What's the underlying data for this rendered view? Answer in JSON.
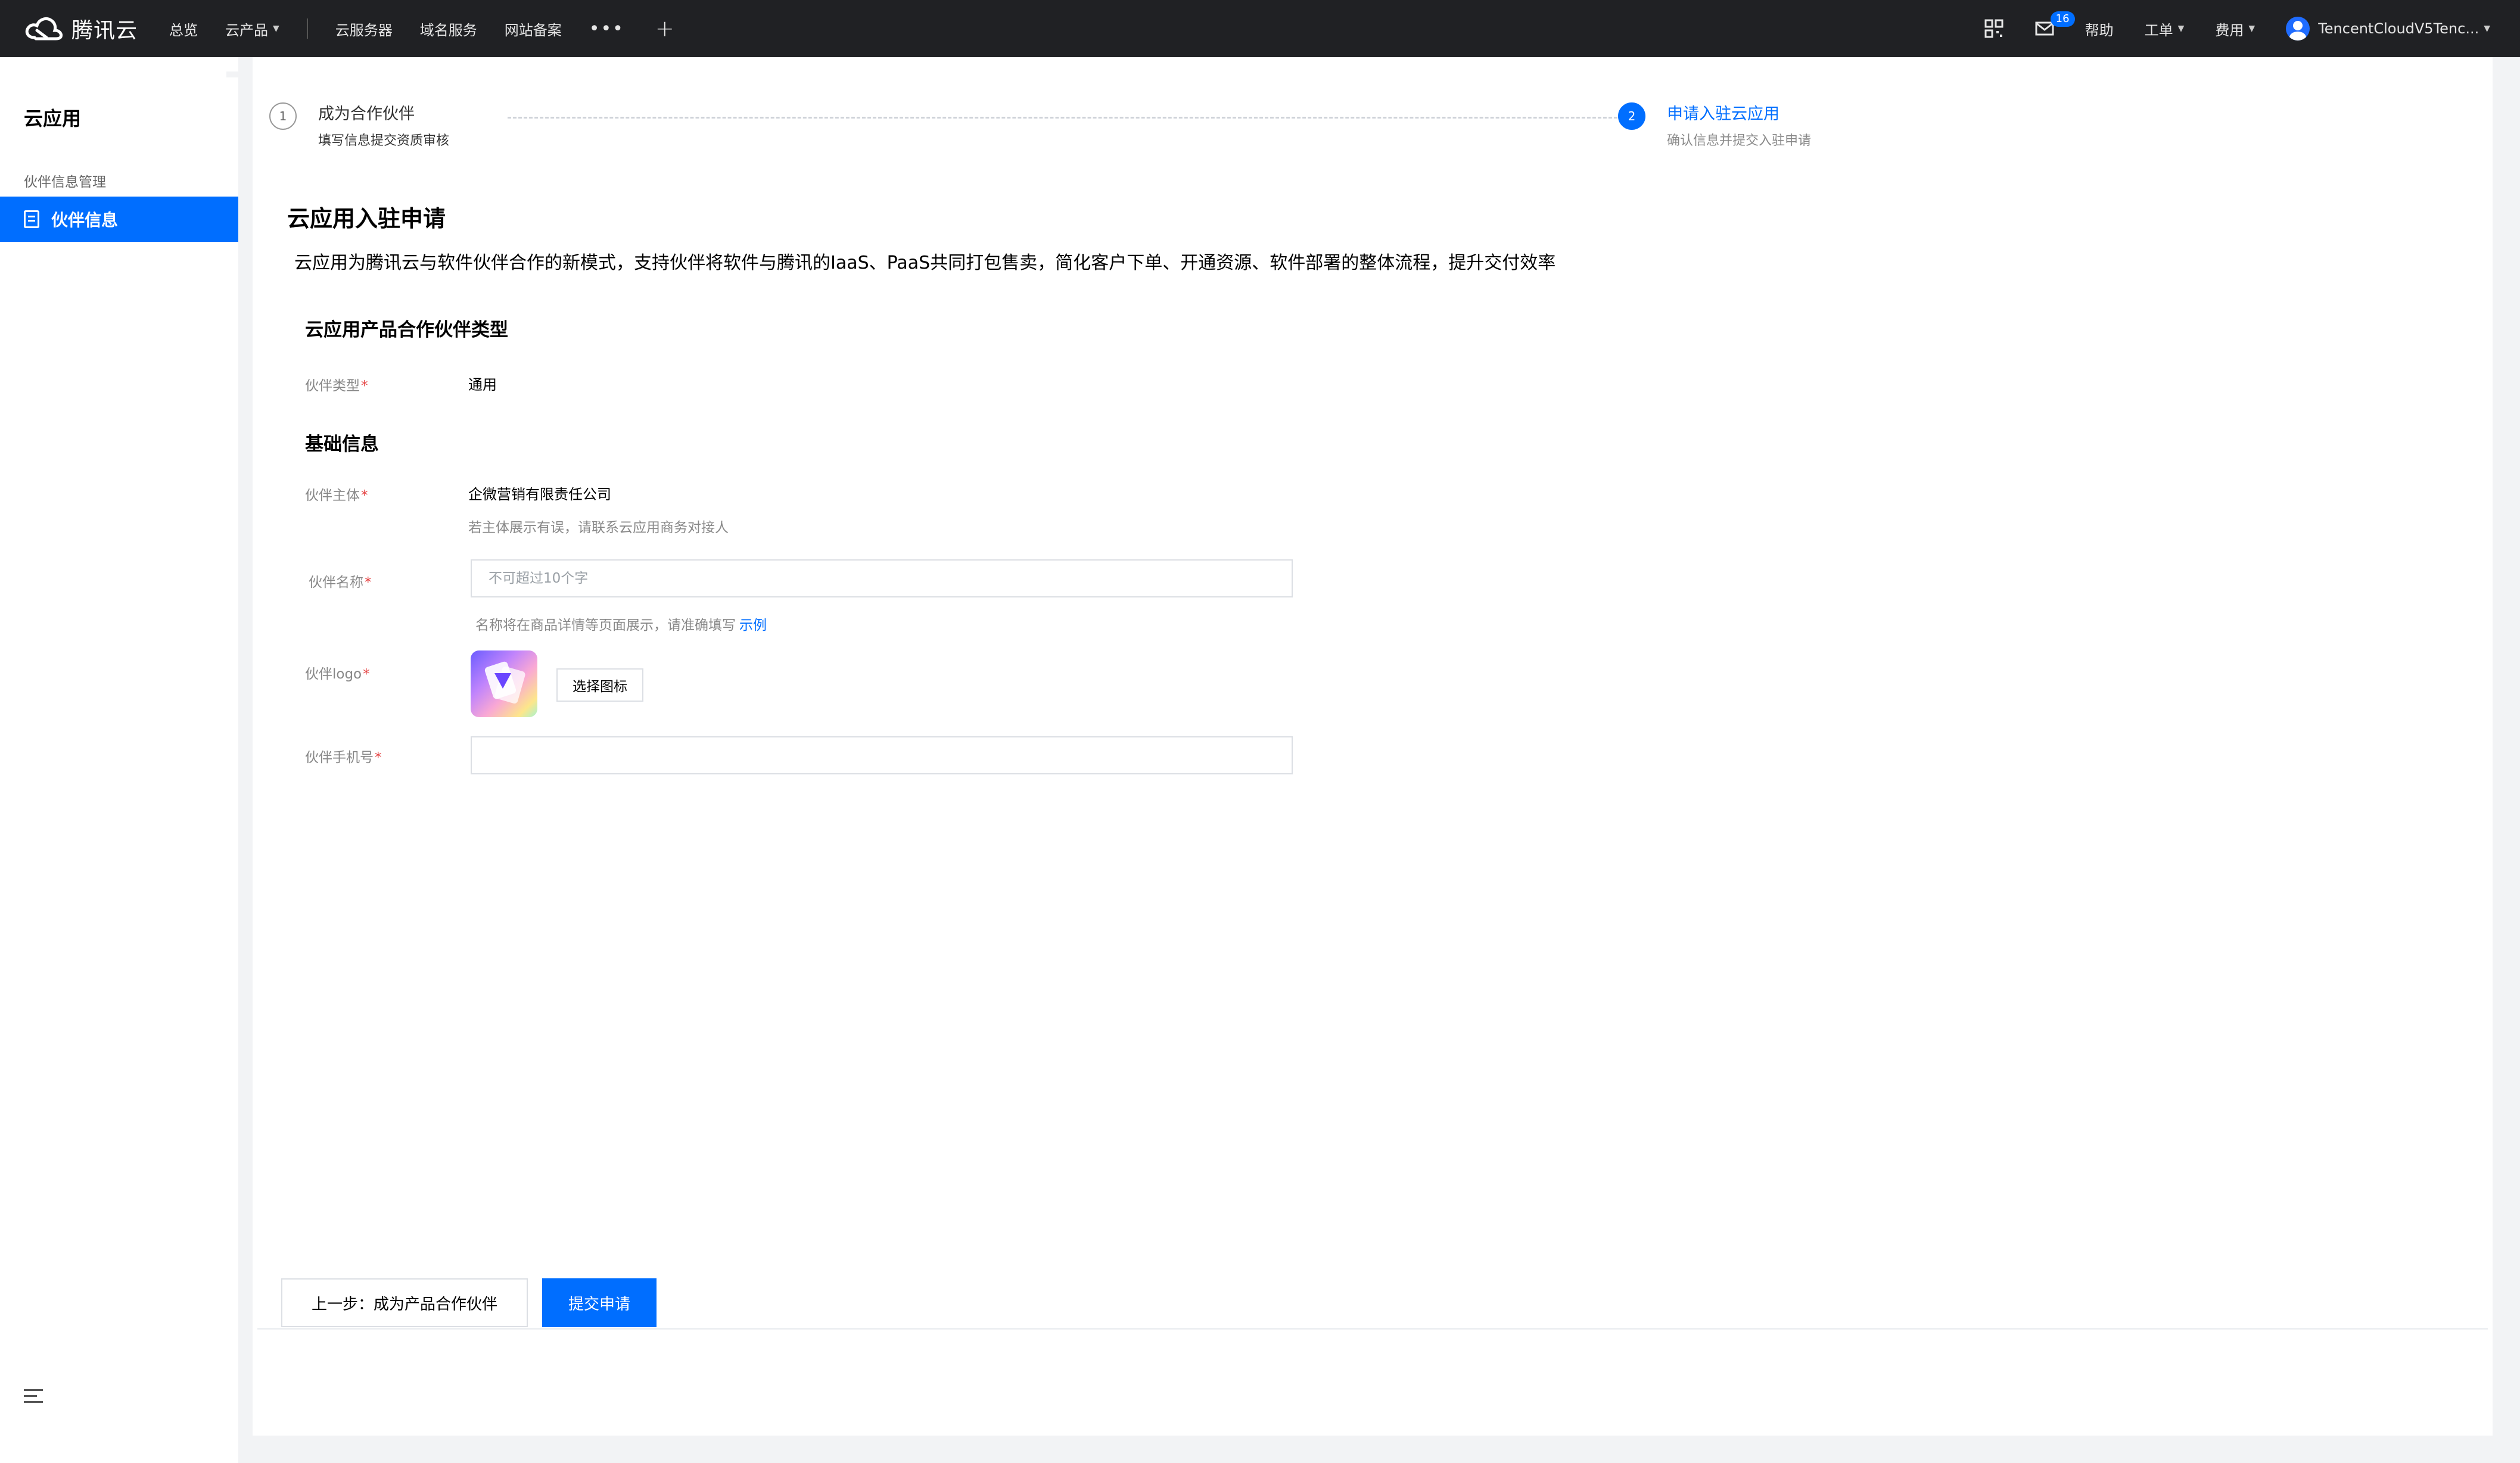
{
  "topbar": {
    "logo_text": "腾讯云",
    "nav": {
      "overview": "总览",
      "products": "云产品",
      "cvm": "云服务器",
      "domain": "域名服务",
      "icp": "网站备案",
      "more": "•••",
      "add": "+"
    },
    "right": {
      "mail_count": "16",
      "help": "帮助",
      "ticket": "工单",
      "billing": "费用",
      "account": "TencentCloudV5Tenc..."
    }
  },
  "sidebar": {
    "title": "云应用",
    "group": "伙伴信息管理",
    "active_item": "伙伴信息"
  },
  "steps": [
    {
      "num": "1",
      "title": "成为合作伙伴",
      "desc": "填写信息提交资质审核"
    },
    {
      "num": "2",
      "title": "申请入驻云应用",
      "desc": "确认信息并提交入驻申请"
    }
  ],
  "page": {
    "title": "云应用入驻申请",
    "desc": "云应用为腾讯云与软件伙伴合作的新模式，支持伙伴将软件与腾讯的IaaS、PaaS共同打包售卖，简化客户下单、开通资源、软件部署的整体流程，提升交付效率"
  },
  "section_type": {
    "title": "云应用产品合作伙伴类型",
    "partner_type_label": "伙伴类型",
    "partner_type_value": "通用"
  },
  "section_basic": {
    "title": "基础信息",
    "entity_label": "伙伴主体",
    "entity_value": "企微营销有限责任公司",
    "entity_hint": "若主体展示有误，请联系云应用商务对接人",
    "name_label": "伙伴名称",
    "name_placeholder": "不可超过10个字",
    "name_value": "",
    "name_hint": "名称将在商品详情等页面展示，请准确填写",
    "name_hint_link": "示例",
    "logo_label": "伙伴logo",
    "logo_button": "选择图标",
    "phone_label": "伙伴手机号",
    "phone_value": ""
  },
  "footer": {
    "prev": "上一步：成为产品合作伙伴",
    "submit": "提交申请"
  },
  "colors": {
    "primary": "#006eff",
    "topbar": "#202124",
    "required": "#e54545"
  }
}
